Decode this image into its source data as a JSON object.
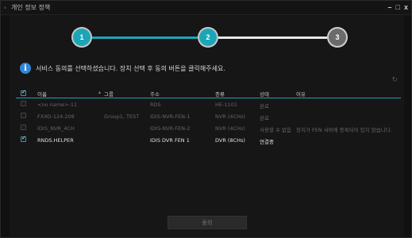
{
  "window": {
    "title": "개인 정보 정책",
    "app_icon": "app-icon",
    "controls": {
      "minimize": "–",
      "maximize": "□",
      "close": "x"
    }
  },
  "stepper": {
    "steps": [
      {
        "label": "1",
        "state": "done"
      },
      {
        "label": "2",
        "state": "current"
      },
      {
        "label": "3",
        "state": "pending"
      }
    ],
    "active_color": "#1aa6b7"
  },
  "notice": {
    "icon": "info-icon",
    "text": "서비스 동의를 선택하셨습니다. 장치 선택 후 동의 버튼을 클릭해주세요."
  },
  "table": {
    "headers": {
      "name": "이름",
      "group": "그룹",
      "address": "주소",
      "type": "종류",
      "state": "상태",
      "reason": "이유"
    },
    "header_checked": true,
    "rows": [
      {
        "checked": false,
        "name": "<no name>-11",
        "group": "",
        "address": "RDS",
        "type": "HE-1101",
        "state": "완료",
        "reason": ""
      },
      {
        "checked": false,
        "name": "FXXO-124.208",
        "group": "Group1, TEST",
        "address": "IDIS-NVR-FEN-1",
        "type": "NVR (4CHs)",
        "state": "완료",
        "reason": ""
      },
      {
        "checked": false,
        "name": "IDIS_NVR_4CH",
        "group": "",
        "address": "IDIS-NVR-FEN-2",
        "type": "NVR (4CHs)",
        "state": "사용할 수 없음",
        "reason": "장치가 FEN 서버에 등록되어 있지 않습니다."
      },
      {
        "checked": true,
        "name": "RNDS.HELPER",
        "group": "",
        "address": "IDIS DVR FEN 1",
        "type": "DVR (8CHs)",
        "state": "연결중",
        "reason": ""
      }
    ]
  },
  "footer": {
    "next_label": "동의"
  }
}
